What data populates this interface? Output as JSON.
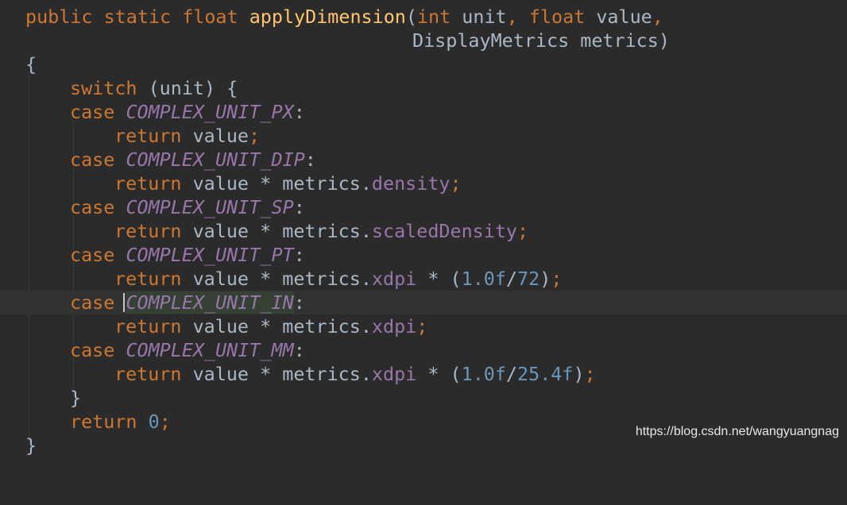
{
  "code": {
    "sig1": {
      "mod1": "public",
      "mod2": "static",
      "ret": "float",
      "name": "applyDimension",
      "open": "(",
      "t1": "int",
      "p1": "unit",
      "comma": ",",
      "t2": "float",
      "p2": "value",
      "comma2": ","
    },
    "sig2": {
      "t3": "DisplayMetrics",
      "p3": "metrics",
      "close": ")"
    },
    "brace_open": "{",
    "switch": {
      "kw": "switch",
      "expr": "(unit) {"
    },
    "cases": [
      {
        "kw": "case",
        "const": "COMPLEX_UNIT_PX",
        "colon": ":",
        "ret": "return",
        "expr": "value",
        "semi": ";"
      },
      {
        "kw": "case",
        "const": "COMPLEX_UNIT_DIP",
        "colon": ":",
        "ret": "return",
        "expr": "value * metrics.",
        "field": "density",
        "semi": ";"
      },
      {
        "kw": "case",
        "const": "COMPLEX_UNIT_SP",
        "colon": ":",
        "ret": "return",
        "expr": "value * metrics.",
        "field": "scaledDensity",
        "semi": ";"
      },
      {
        "kw": "case",
        "const": "COMPLEX_UNIT_PT",
        "colon": ":",
        "ret": "return",
        "expr": "value * metrics.",
        "field": "xdpi",
        "mid": " * (",
        "n1": "1.0f",
        "slash": "/",
        "n2": "72",
        "tail": ")",
        "semi": ";"
      },
      {
        "kw": "case",
        "const": "COMPLEX_UNIT_IN",
        "colon": ":",
        "ret": "return",
        "expr": "value * metrics.",
        "field": "xdpi",
        "semi": ";"
      },
      {
        "kw": "case",
        "const": "COMPLEX_UNIT_MM",
        "colon": ":",
        "ret": "return",
        "expr": "value * metrics.",
        "field": "xdpi",
        "mid": " * (",
        "n1": "1.0f",
        "slash": "/",
        "n2": "25.4f",
        "tail": ")",
        "semi": ";"
      }
    ],
    "switch_close": "}",
    "final_return": {
      "kw": "return",
      "num": "0",
      "semi": ";"
    },
    "brace_close": "}"
  },
  "watermark": "https://blog.csdn.net/wangyuangnag",
  "colors": {
    "background": "#2b2b2b",
    "keyword": "#cc7832",
    "function": "#ffc66d",
    "constant": "#9876aa",
    "number": "#6897bb",
    "text": "#a9b7c6"
  }
}
